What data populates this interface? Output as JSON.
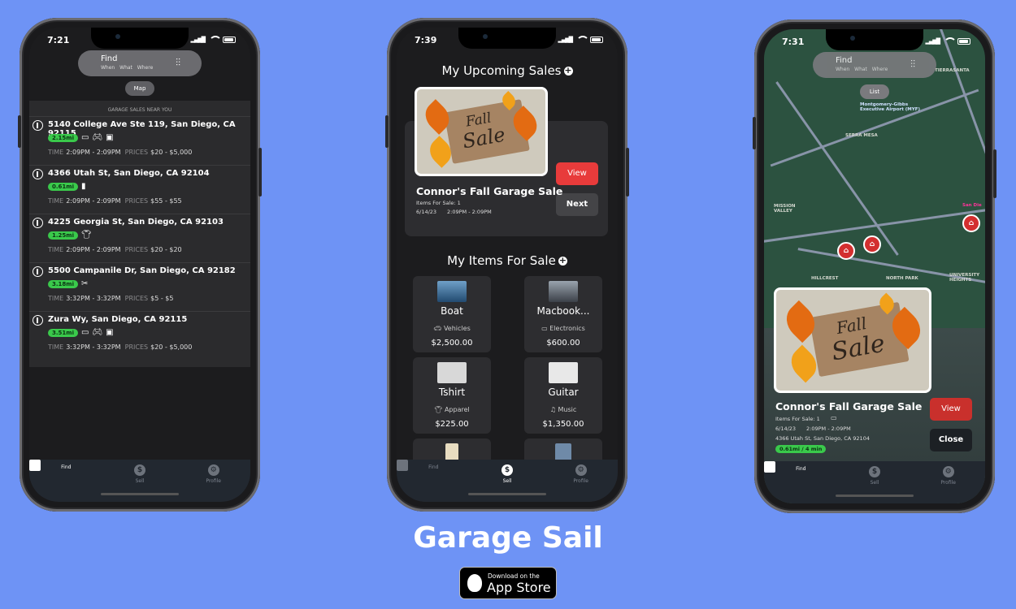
{
  "phone1": {
    "status_time": "7:21",
    "find": {
      "title": "Find",
      "subtitle": "When  What  Where"
    },
    "toggle_label": "Map",
    "list_header": "GARAGE SALES NEAR YOU",
    "sales": [
      {
        "address": "5140 College Ave Ste 119, San Diego, CA 92115",
        "distance": "2.15mi",
        "categories": [
          "electronics-icon",
          "gamepad-icon",
          "monitor-icon"
        ],
        "time": "2:09PM - 2:09PM",
        "prices": "$20 - $5,000"
      },
      {
        "address": "4366 Utah St, San Diego, CA 92104",
        "distance": "0.61mi",
        "categories": [
          "ticket-icon"
        ],
        "time": "2:09PM - 2:09PM",
        "prices": "$55 - $55"
      },
      {
        "address": "4225 Georgia St, San Diego, CA 92103",
        "distance": "1.25mi",
        "categories": [
          "shirt-icon"
        ],
        "time": "2:09PM - 2:09PM",
        "prices": "$20 - $20"
      },
      {
        "address": "5500 Campanile Dr, San Diego, CA 92182",
        "distance": "3.18mi",
        "categories": [
          "tools-icon"
        ],
        "time": "3:32PM - 3:32PM",
        "prices": "$5 - $5"
      },
      {
        "address": "Zura Wy, San Diego, CA 92115",
        "distance": "3.51mi",
        "categories": [
          "electronics-icon",
          "gamepad-icon",
          "monitor-icon"
        ],
        "time": "3:32PM - 3:32PM",
        "prices": "$20 - $5,000"
      }
    ],
    "time_label": "TIME",
    "prices_label": "PRICES"
  },
  "tabs": [
    {
      "label": "Find"
    },
    {
      "label": "Sell"
    },
    {
      "label": "Profile"
    }
  ],
  "phone2": {
    "status_time": "7:39",
    "upcoming_title": "My Upcoming Sales",
    "sale": {
      "name": "Connor's Fall Garage Sale",
      "items": "Items For Sale: 1",
      "date": "6/14/23",
      "time": "2:09PM - 2:09PM",
      "image_text_1": "Fall",
      "image_text_2": "Sale"
    },
    "view_label": "View",
    "next_label": "Next",
    "items_title": "My Items For Sale",
    "items": [
      {
        "name": "Boat",
        "category": "Vehicles",
        "price": "$2,500.00"
      },
      {
        "name": "Macbook...",
        "category": "Electronics",
        "price": "$600.00"
      },
      {
        "name": "Tshirt",
        "category": "Apparel",
        "price": "$225.00"
      },
      {
        "name": "Guitar",
        "category": "Music",
        "price": "$1,350.00"
      }
    ]
  },
  "phone3": {
    "status_time": "7:31",
    "find": {
      "title": "Find",
      "subtitle": "When  What  Where"
    },
    "toggle_label": "List",
    "map_labels": [
      "TIERRASANTA",
      "SERRA MESA",
      "MISSION VALLEY",
      "HILLCREST",
      "NORTH PARK",
      "UNIVERSITY HEIGHTS",
      "Montgomery-Gibbs Executive Airport (MYF)",
      "San Die"
    ],
    "sale": {
      "name": "Connor's Fall Garage Sale",
      "items": "Items For Sale: 1",
      "date": "6/14/23",
      "time": "2:09PM - 2:09PM",
      "address": "4366 Utah St, San Diego, CA 92104",
      "distance": "0.61mi / 4 min",
      "image_text_1": "Fall",
      "image_text_2": "Sale"
    },
    "view_label": "View",
    "close_label": "Close"
  },
  "brand": "Garage Sail",
  "appstore": {
    "line1": "Download on the",
    "line2": "App Store"
  },
  "colors": {
    "background": "#6e93f5",
    "accent_red": "#e83b3b",
    "distance_green": "#3ac94b"
  }
}
